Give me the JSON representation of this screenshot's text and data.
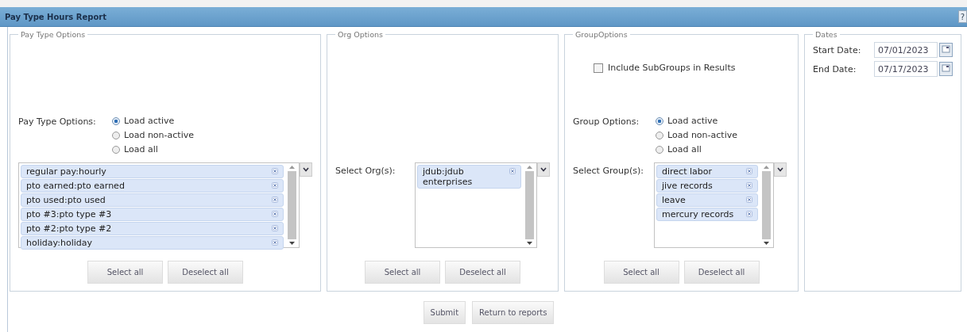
{
  "window": {
    "title": "Pay Type Hours Report",
    "help": "?"
  },
  "sections": [
    {
      "legend": "Pay Type Options",
      "options_label": "Pay Type Options:",
      "options": [
        {
          "label": "Load active",
          "selected": true
        },
        {
          "label": "Load non-active",
          "selected": false
        },
        {
          "label": "Load all",
          "selected": false
        }
      ],
      "list_items": [
        "regular pay:hourly",
        "pto earned:pto earned",
        "pto used:pto used",
        "pto #3:pto type #3",
        "pto #2:pto type #2",
        "holiday:holiday"
      ],
      "buttons": [
        "Select all",
        "Deselect all"
      ]
    },
    {
      "legend": "Org Options",
      "list_label": "Select Org(s):",
      "list_items": [
        "jdub:jdub enterprises"
      ],
      "buttons": [
        "Select all",
        "Deselect all"
      ]
    },
    {
      "legend": "GroupOptions",
      "checkbox": {
        "label": "Include SubGroups in Results",
        "checked": false
      },
      "options_label": "Group Options:",
      "options": [
        {
          "label": "Load active",
          "selected": true
        },
        {
          "label": "Load non-active",
          "selected": false
        },
        {
          "label": "Load all",
          "selected": false
        }
      ],
      "list_label": "Select Group(s):",
      "list_items": [
        "direct labor",
        "jive records",
        "leave",
        "mercury records"
      ],
      "buttons": [
        "Select all",
        "Deselect all"
      ]
    }
  ],
  "dates": {
    "legend": "Dates",
    "fields": [
      {
        "label": "Start Date:",
        "value": "07/01/2023"
      },
      {
        "label": "End Date:",
        "value": "07/17/2023"
      }
    ]
  },
  "actions": [
    "Submit",
    "Return to reports"
  ]
}
